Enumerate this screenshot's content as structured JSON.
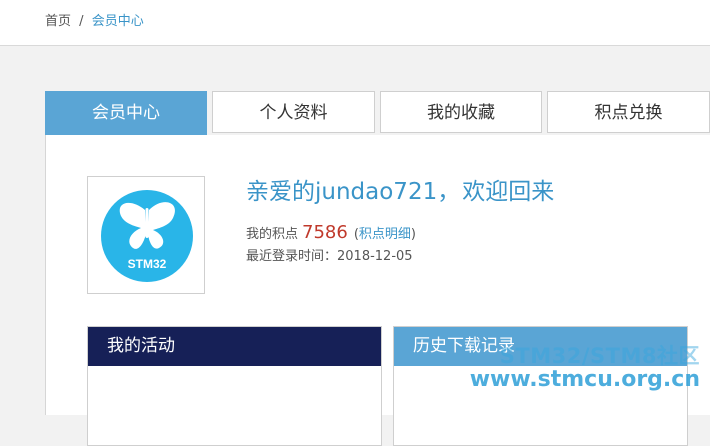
{
  "breadcrumb": {
    "home": "首页",
    "separator": "/",
    "current": "会员中心"
  },
  "tabs": [
    {
      "label": "会员中心",
      "active": true
    },
    {
      "label": "个人资料",
      "active": false
    },
    {
      "label": "我的收藏",
      "active": false
    },
    {
      "label": "积点兑换",
      "active": false
    }
  ],
  "profile": {
    "avatar_text": "STM32",
    "avatar_icon": "butterfly-logo",
    "welcome_prefix": "亲爱的",
    "username": "jundao721",
    "welcome_comma": "，",
    "welcome_suffix": "欢迎回来",
    "points_label": "我的积点",
    "points_value": "7586",
    "paren_open": "(",
    "points_detail_link": "积点明细",
    "paren_close": ")",
    "last_login_label": "最近登录时间：",
    "last_login_value": "2018-12-05"
  },
  "sections": {
    "activity_title": "我的活动",
    "download_title": "历史下载记录"
  },
  "watermark": {
    "line1": "STM32/STM8社区",
    "line2": "www.stmcu.org.cn"
  },
  "colors": {
    "accent": "#5aa5d5",
    "dark_header": "#162057",
    "link": "#3a94c8",
    "points": "#c0392b",
    "avatar_circle": "#29b5e8"
  }
}
